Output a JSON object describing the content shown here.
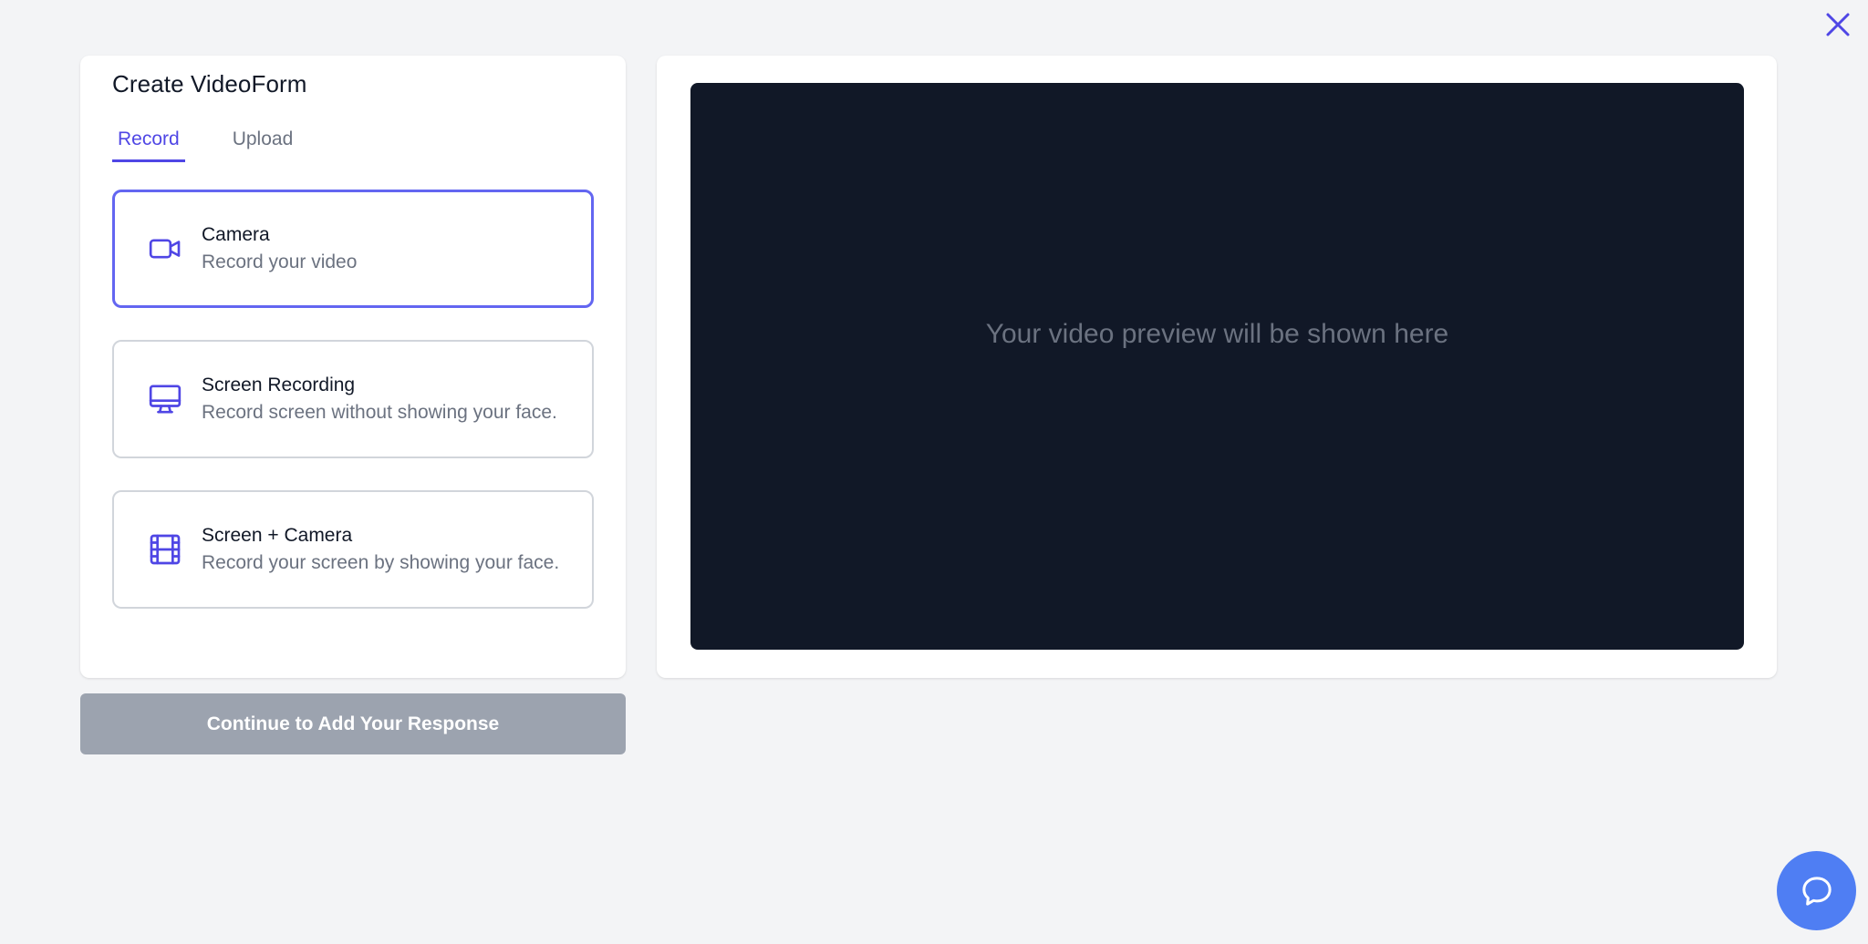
{
  "header": {
    "close_label": "close"
  },
  "form": {
    "title": "Create VideoForm",
    "tabs": [
      {
        "label": "Record",
        "active": true
      },
      {
        "label": "Upload",
        "active": false
      }
    ],
    "options": [
      {
        "title": "Camera",
        "description": "Record your video",
        "icon": "video-camera-icon",
        "selected": true
      },
      {
        "title": "Screen Recording",
        "description": "Record screen without showing your face.",
        "icon": "monitor-icon",
        "selected": false
      },
      {
        "title": "Screen + Camera",
        "description": "Record your screen by showing your face.",
        "icon": "film-icon",
        "selected": false
      }
    ],
    "continue_label": "Continue to Add Your Response"
  },
  "preview": {
    "placeholder": "Your video preview will be shown here"
  },
  "colors": {
    "accent": "#4f46e5",
    "background": "#f3f4f6",
    "preview_bg": "#111827",
    "button_disabled": "#9ca3af",
    "chat_button": "#4f7ef3"
  }
}
